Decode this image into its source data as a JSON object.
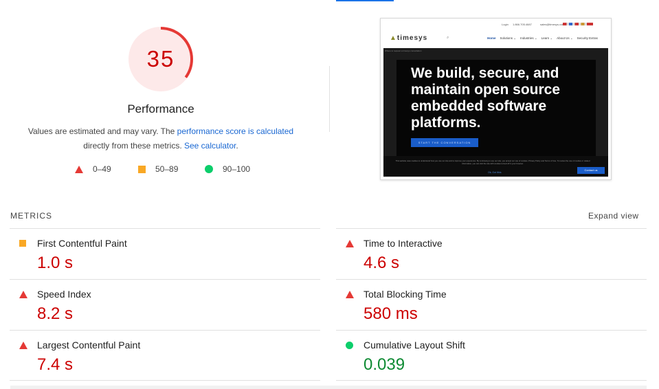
{
  "gauge": {
    "score": "35",
    "score_fraction": 0.35,
    "color": "#e53935",
    "bg_color": "#fde9e9"
  },
  "performance": {
    "title": "Performance",
    "desc_prefix": "Values are estimated and may vary. The ",
    "desc_link1": "performance score is calculated",
    "desc_middle": " directly from these metrics. ",
    "desc_link2": "See calculator",
    "desc_suffix": "."
  },
  "legend": {
    "poor": {
      "label": "0–49",
      "icon": "red-triangle-icon",
      "color": "#e53935"
    },
    "average": {
      "label": "50–89",
      "icon": "orange-square-icon",
      "color": "#f9a825"
    },
    "good": {
      "label": "90–100",
      "icon": "green-circle-icon",
      "color": "#0cce6b"
    }
  },
  "screenshot": {
    "topbar_login": "Login",
    "topbar_phone": "1.866.705.4687",
    "topbar_email": "sales@timesys.com",
    "logo_prefix": "▲",
    "logo_text": "timesys",
    "nav": [
      "Home",
      "Solutions ⌄",
      "Industries ⌄",
      "Learn ⌄",
      "About Us ⌄",
      "Security Extras"
    ],
    "breadcrumb": "Where to request a timesys consultation",
    "headline": "We build, secure, and maintain open source embedded software platforms.",
    "cta": "START THE CONVERSATION",
    "cookie_text": "This website uses cookies to understand how you use our site and to improve your experience. By continuing to use our site, you accept our use of cookies, Privacy Policy and Terms of Use. To review the use of cookies or related information, you can visit the site with cookies turned off in your browser.",
    "cookie_ok": "Ok, Got Ithis",
    "contact": "Contact us"
  },
  "metrics": {
    "heading": "METRICS",
    "expand": "Expand view",
    "items": [
      {
        "name": "First Contentful Paint",
        "value": "1.0 s",
        "rating": "average"
      },
      {
        "name": "Time to Interactive",
        "value": "4.6 s",
        "rating": "poor"
      },
      {
        "name": "Speed Index",
        "value": "8.2 s",
        "rating": "poor"
      },
      {
        "name": "Total Blocking Time",
        "value": "580 ms",
        "rating": "poor"
      },
      {
        "name": "Largest Contentful Paint",
        "value": "7.4 s",
        "rating": "poor"
      },
      {
        "name": "Cumulative Layout Shift",
        "value": "0.039",
        "rating": "good"
      }
    ]
  }
}
